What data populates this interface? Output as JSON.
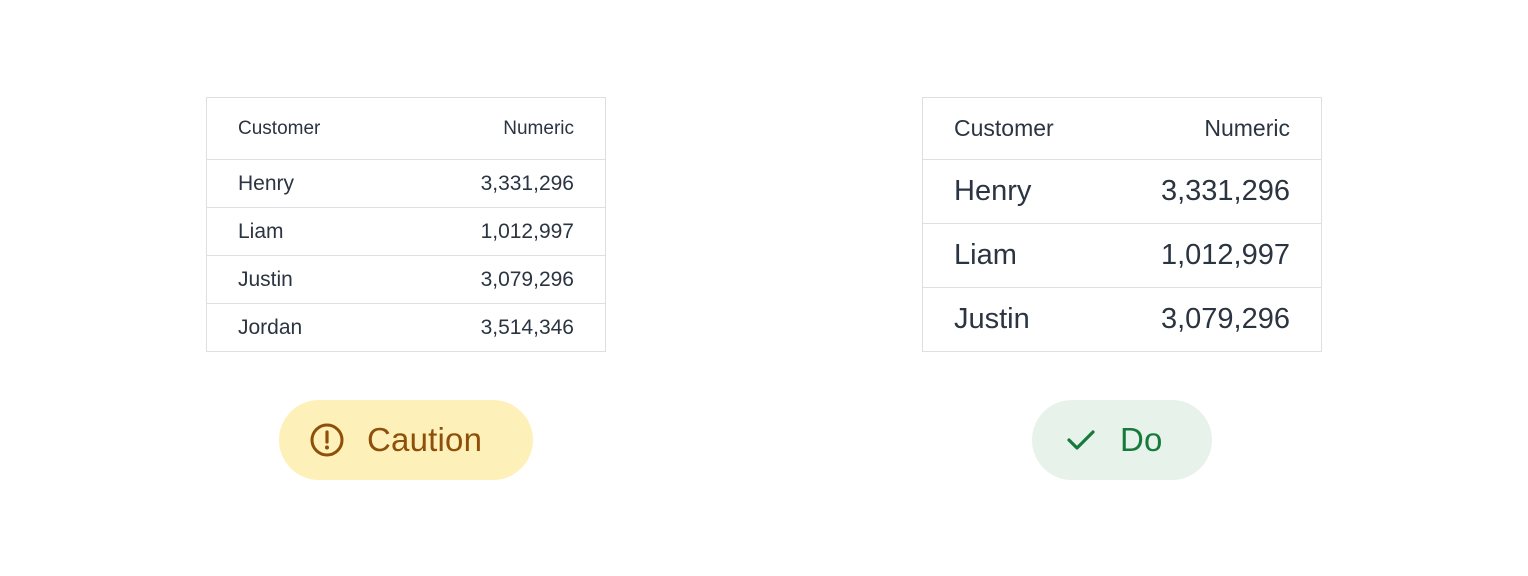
{
  "caution_table": {
    "headers": [
      "Customer",
      "Numeric"
    ],
    "rows": [
      {
        "customer": "Henry",
        "numeric": "3,331,296"
      },
      {
        "customer": "Liam",
        "numeric": "1,012,997"
      },
      {
        "customer": "Justin",
        "numeric": "3,079,296"
      },
      {
        "customer": "Jordan",
        "numeric": "3,514,346"
      }
    ]
  },
  "do_table": {
    "headers": [
      "Customer",
      "Numeric"
    ],
    "rows": [
      {
        "customer": "Henry",
        "numeric": "3,331,296"
      },
      {
        "customer": "Liam",
        "numeric": "1,012,997"
      },
      {
        "customer": "Justin",
        "numeric": "3,079,296"
      }
    ]
  },
  "badges": {
    "caution": {
      "label": "Caution",
      "icon": "exclamation-circle-icon",
      "background": "#fdf0b8",
      "color": "#8d4f0a"
    },
    "do": {
      "label": "Do",
      "icon": "check-icon",
      "background": "#e6f2ea",
      "color": "#177a3c"
    }
  }
}
